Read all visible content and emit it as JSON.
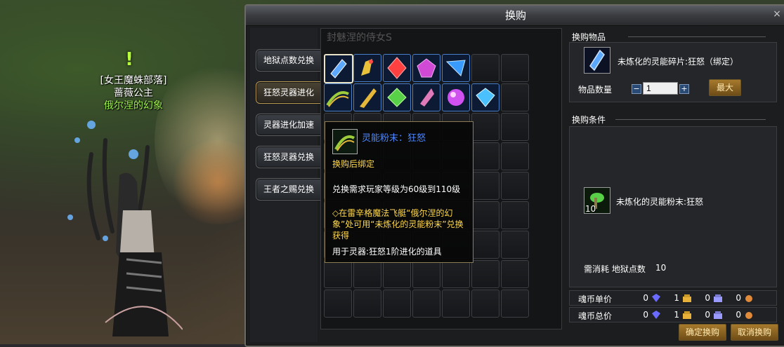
{
  "npc": {
    "guild": "[女王魔蛛部落]",
    "name": "蔷薇公主",
    "title": "俄尔涅的幻象"
  },
  "window": {
    "title": "换购",
    "close": "×"
  },
  "tabs": [
    {
      "label": "地狱点数兑换"
    },
    {
      "label": "狂怒灵器进化"
    },
    {
      "label": "灵器进化加速"
    },
    {
      "label": "狂怒灵器兑换"
    },
    {
      "label": "王者之赐兑换"
    }
  ],
  "grid": {
    "watermark": "封魅涅的侍女S",
    "items": [
      {
        "name": "未炼化的灵能碎片:狂怒",
        "color": "#5da8ff"
      },
      {
        "name": "crystal-shard-yellow",
        "color": "#e9c23a"
      },
      {
        "name": "crystal-red",
        "color": "#ff4040"
      },
      {
        "name": "crystal-purple",
        "color": "#d04ad6"
      },
      {
        "name": "crystal-blue",
        "color": "#3a9bff"
      },
      {
        "name": "灵能粉末：狂怒",
        "color": "#9ccc3a"
      },
      {
        "name": "feather-gold",
        "color": "#e5b83a"
      },
      {
        "name": "gem-green",
        "color": "#58d048"
      },
      {
        "name": "gem-pink",
        "color": "#e07ab8"
      },
      {
        "name": "orb-purple",
        "color": "#d050f0"
      },
      {
        "name": "diamond-blue",
        "color": "#4ac0ff"
      }
    ]
  },
  "tooltip": {
    "name": "灵能粉末：狂怒",
    "bind": "换购后绑定",
    "requirement": "兑换需求玩家等级为60级到110级",
    "description": "◇在雷辛格魔法飞艇“俄尔涅的幻象”处可用“未炼化的灵能粉末”兑换获得",
    "usage": "用于灵器:狂怒1阶进化的道具"
  },
  "exchange_item": {
    "section": "换购物品",
    "name": "未炼化的灵能碎片:狂怒（绑定）",
    "qty_label": "物品数量",
    "qty_value": "1",
    "minus": "−",
    "plus": "+",
    "max_label": "最大"
  },
  "conditions": {
    "section": "换购条件",
    "item_name": "未炼化的灵能粉末:狂怒",
    "item_count": "10",
    "cost_label": "需消耗 地狱点数",
    "cost_value": "10"
  },
  "prices": [
    {
      "label": "魂币单价",
      "values": [
        "0",
        "1",
        "0",
        "0"
      ]
    },
    {
      "label": "魂币总价",
      "values": [
        "0",
        "1",
        "0",
        "0"
      ]
    }
  ],
  "coin_colors": [
    "#6a6aff",
    "#e8b23a",
    "#9a9aff",
    "#e08a3a"
  ],
  "buttons": {
    "confirm": "确定换购",
    "cancel": "取消换购"
  }
}
